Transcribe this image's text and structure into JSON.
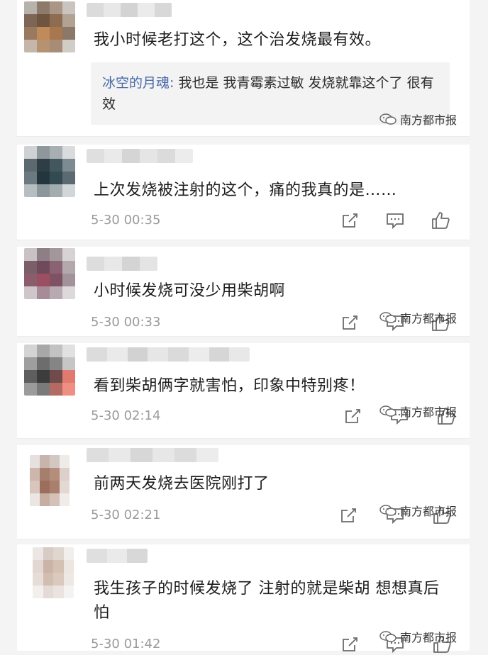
{
  "watermark": "南方都市报",
  "comments": [
    {
      "text": "我小时候老打这个，这个治发烧最有效。",
      "reply_author": "冰空的月魂:",
      "reply_text": " 我也是 我青霉素过敏 发烧就靠这个了 很有效"
    },
    {
      "text": "上次发烧被注射的这个，痛的我真的是……",
      "time": "5-30 00:35"
    },
    {
      "text": "小时候发烧可没少用柴胡啊",
      "time": "5-30 00:33"
    },
    {
      "text": "看到柴胡俩字就害怕，印象中特别疼！",
      "time": "5-30 02:14"
    },
    {
      "text": "前两天发烧去医院刚打了",
      "time": "5-30 02:21"
    },
    {
      "text": "我生孩子的时候发烧了 注射的就是柴胡 想想真后怕",
      "time": "5-30 01:42"
    }
  ],
  "icons": [
    "share-icon",
    "reply-icon",
    "like-icon",
    "wechat-watermark-icon"
  ]
}
